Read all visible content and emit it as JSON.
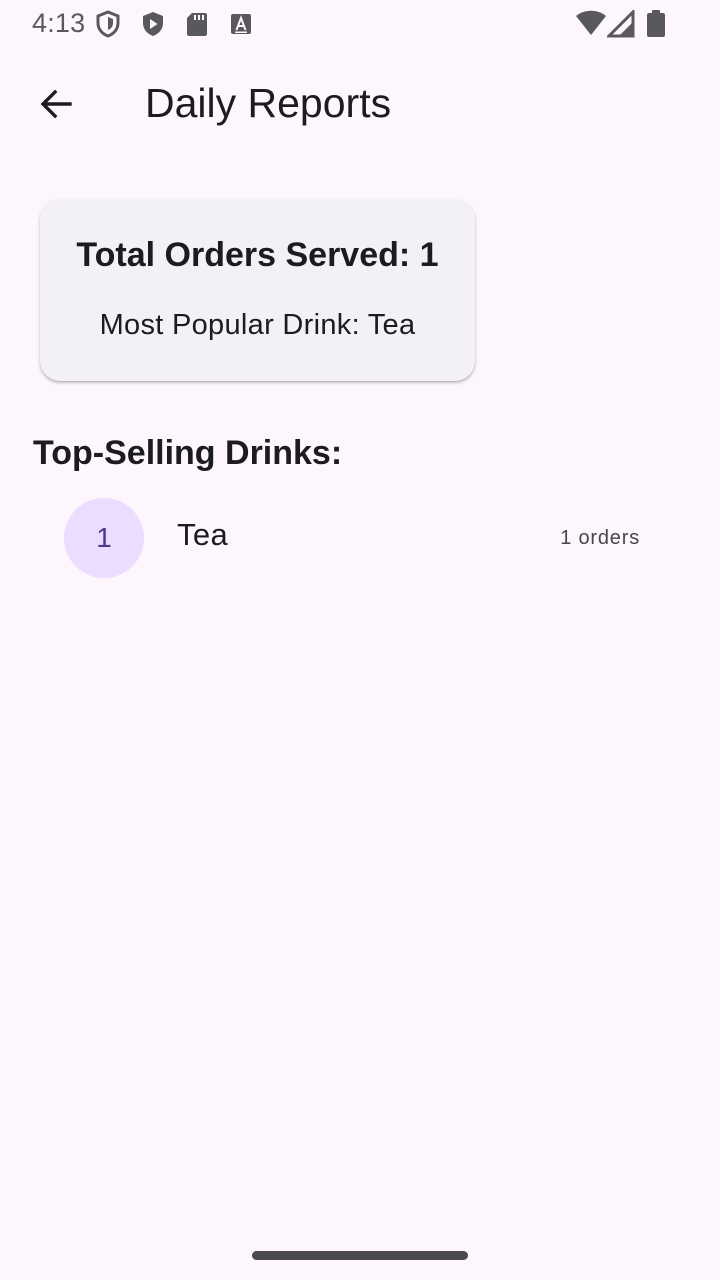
{
  "status_bar": {
    "time": "4:13",
    "icons_left": [
      "shield-outline-icon",
      "play-protect-icon",
      "sd-card-icon",
      "font-icon"
    ],
    "icons_right": [
      "wifi-icon",
      "cell-signal-icon",
      "battery-icon"
    ]
  },
  "app_bar": {
    "back_icon": "arrow-back-icon",
    "title": "Daily Reports"
  },
  "summary": {
    "total_orders": "Total Orders Served: 1",
    "most_popular": "Most Popular Drink: Tea"
  },
  "top_selling": {
    "heading": "Top-Selling Drinks:",
    "items": [
      {
        "rank": "1",
        "name": "Tea",
        "orders": "1 orders"
      }
    ]
  },
  "colors": {
    "background": "#FDF7FD",
    "card": "#F4F1F6",
    "avatar": "#EADDFF",
    "avatar_text": "#4F378B"
  }
}
